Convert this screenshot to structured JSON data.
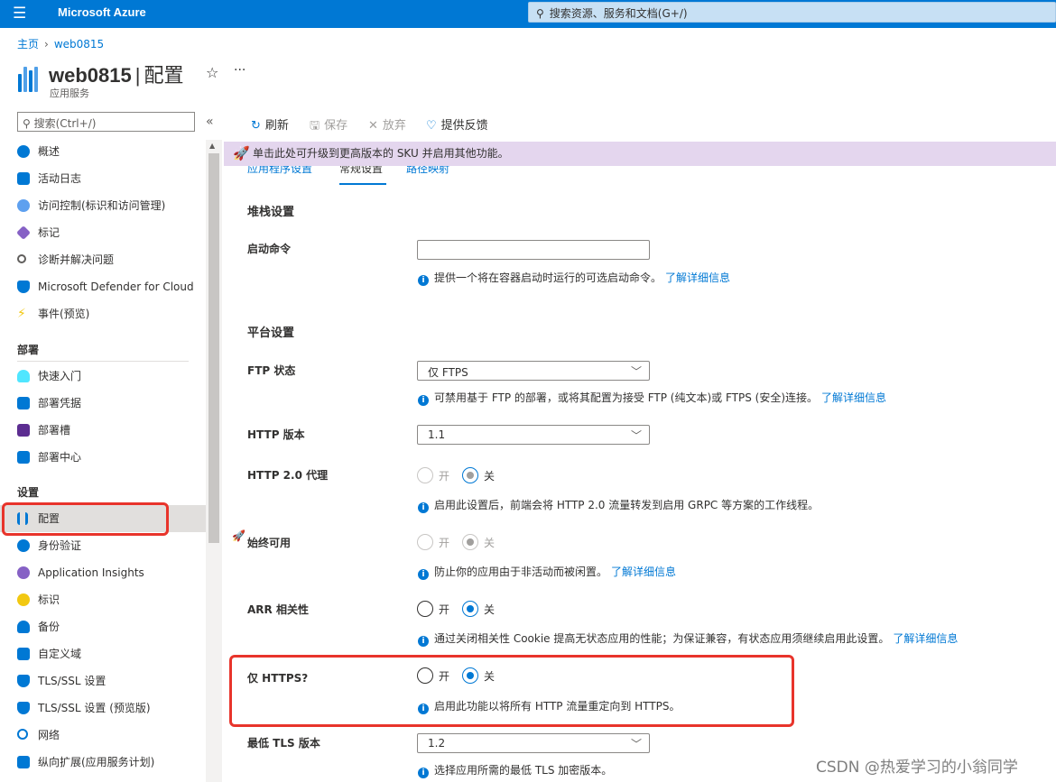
{
  "topbar": {
    "brand": "Microsoft Azure",
    "search_placeholder": "搜索资源、服务和文档(G+/)"
  },
  "breadcrumb": {
    "home": "主页",
    "current": "web0815"
  },
  "header": {
    "title": "web0815",
    "section": "配置",
    "subtitle": "应用服务"
  },
  "sidebar": {
    "search": "搜索(Ctrl+/)",
    "items": [
      {
        "label": "概述",
        "color": "#0078d4"
      },
      {
        "label": "活动日志",
        "color": "#0078d4"
      },
      {
        "label": "访问控制(标识和访问管理)",
        "color": "#5ea0ef"
      },
      {
        "label": "标记",
        "color": "#8661c5"
      },
      {
        "label": "诊断并解决问题",
        "color": "#605e5c"
      },
      {
        "label": "Microsoft Defender for Cloud",
        "color": "#0078d4"
      },
      {
        "label": "事件(预览)",
        "color": "#f2c811"
      }
    ],
    "deploy_header": "部署",
    "deploy_items": [
      {
        "label": "快速入门",
        "color": "#50e6ff"
      },
      {
        "label": "部署凭据",
        "color": "#0078d4"
      },
      {
        "label": "部署槽",
        "color": "#5c2d91"
      },
      {
        "label": "部署中心",
        "color": "#0078d4"
      }
    ],
    "settings_header": "设置",
    "settings_items": [
      {
        "label": "配置",
        "color": "#0078d4"
      },
      {
        "label": "身份验证",
        "color": "#0078d4"
      },
      {
        "label": "Application Insights",
        "color": "#8661c5"
      },
      {
        "label": "标识",
        "color": "#f2c811"
      },
      {
        "label": "备份",
        "color": "#0078d4"
      },
      {
        "label": "自定义域",
        "color": "#0078d4"
      },
      {
        "label": "TLS/SSL 设置",
        "color": "#0078d4"
      },
      {
        "label": "TLS/SSL 设置 (预览版)",
        "color": "#0078d4"
      },
      {
        "label": "网络",
        "color": "#0078d4"
      },
      {
        "label": "纵向扩展(应用服务计划)",
        "color": "#0078d4"
      }
    ]
  },
  "toolbar": {
    "refresh": "刷新",
    "save": "保存",
    "discard": "放弃",
    "feedback": "提供反馈"
  },
  "banner": "单击此处可升级到更高版本的 SKU 并启用其他功能。",
  "tabs": [
    "应用程序设置",
    "常规设置",
    "路径映射"
  ],
  "stack": {
    "section": "堆栈设置",
    "startup_label": "启动命令",
    "startup_value": "",
    "startup_info": "提供一个将在容器启动时运行的可选启动命令。",
    "learn_more": "了解详细信息"
  },
  "platform": {
    "section": "平台设置",
    "ftp_label": "FTP 状态",
    "ftp_value": "仅 FTPS",
    "ftp_info": "可禁用基于 FTP 的部署，或将其配置为接受 FTP (纯文本)或 FTPS (安全)连接。",
    "http_label": "HTTP 版本",
    "http_value": "1.1",
    "http2_label": "HTTP 2.0 代理",
    "http2_info": "启用此设置后，前端会将 HTTP 2.0 流量转发到启用 GRPC 等方案的工作线程。",
    "always_on_label": "始终可用",
    "always_on_info": "防止你的应用由于非活动而被闲置。",
    "arr_label": "ARR 相关性",
    "arr_info": "通过关闭相关性 Cookie 提高无状态应用的性能；为保证兼容，有状态应用须继续启用此设置。",
    "https_label": "仅 HTTPS?",
    "https_info": "启用此功能以将所有 HTTP 流量重定向到 HTTPS。",
    "tls_label": "最低 TLS 版本",
    "tls_value": "1.2",
    "tls_info": "选择应用所需的最低 TLS 加密版本。",
    "on": "开",
    "off": "关"
  },
  "watermark": "CSDN @热爱学习的小翁同学"
}
